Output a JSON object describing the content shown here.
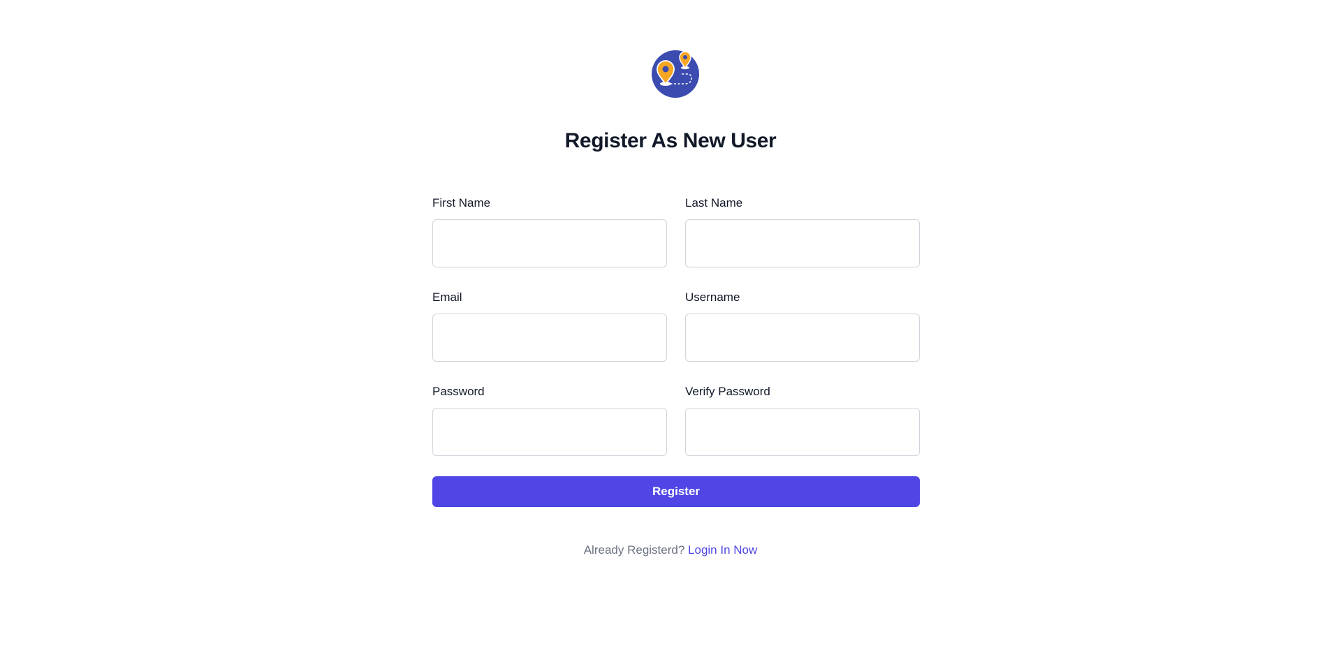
{
  "logo": {
    "icon": "map-route-pins-icon",
    "colors": {
      "circle": "#3b4bb0",
      "pin": "#f5a623"
    }
  },
  "title": "Register As New User",
  "fields": {
    "first_name": {
      "label": "First Name",
      "value": ""
    },
    "last_name": {
      "label": "Last Name",
      "value": ""
    },
    "email": {
      "label": "Email",
      "value": ""
    },
    "username": {
      "label": "Username",
      "value": ""
    },
    "password": {
      "label": "Password",
      "value": ""
    },
    "verify_password": {
      "label": "Verify Password",
      "value": ""
    }
  },
  "register_button": {
    "label": "Register",
    "color": "#4f46e5"
  },
  "footer": {
    "prompt": "Already Registerd?",
    "login_link": "Login In Now"
  }
}
